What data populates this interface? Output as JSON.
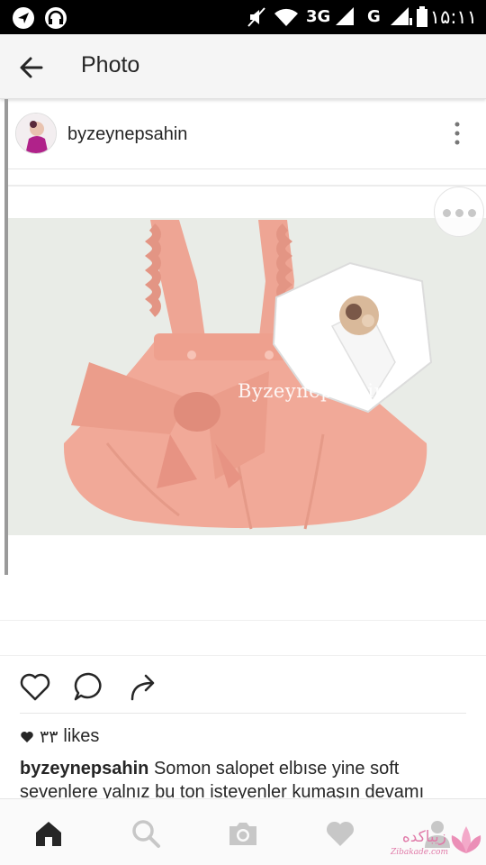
{
  "status_bar": {
    "time": "۱۵:۱۱",
    "network_1": "3G",
    "network_2": "G",
    "icons": [
      "navigation-icon",
      "headphones-icon",
      "mute-icon",
      "wifi-icon",
      "signal-icon",
      "battery-icon"
    ]
  },
  "app_bar": {
    "title": "Photo",
    "back_icon": "arrow-left-icon"
  },
  "post": {
    "username": "byzeynepsahin",
    "photo_watermark": "Byzeynepsahin",
    "actions": [
      "heart-icon",
      "comment-icon",
      "share-icon"
    ],
    "likes_count": "۳۳",
    "likes_label": "likes",
    "caption_user": "byzeynepsahin",
    "caption_text": "Somon salopet elbıse yine soft sevenlere yalnız bu ton isteyenler kumaşın devamı"
  },
  "bottom_nav": {
    "items": [
      "home-icon",
      "search-icon",
      "camera-icon",
      "heart-icon",
      "profile-icon"
    ],
    "watermark_text": "زیباکده",
    "watermark_sub": "Zibakade.com"
  },
  "colors": {
    "status_bar": "#000000",
    "app_bar": "#f5f5f5",
    "dress": "#f1a998",
    "photo_bg": "#e9ece7",
    "text": "#262626"
  }
}
